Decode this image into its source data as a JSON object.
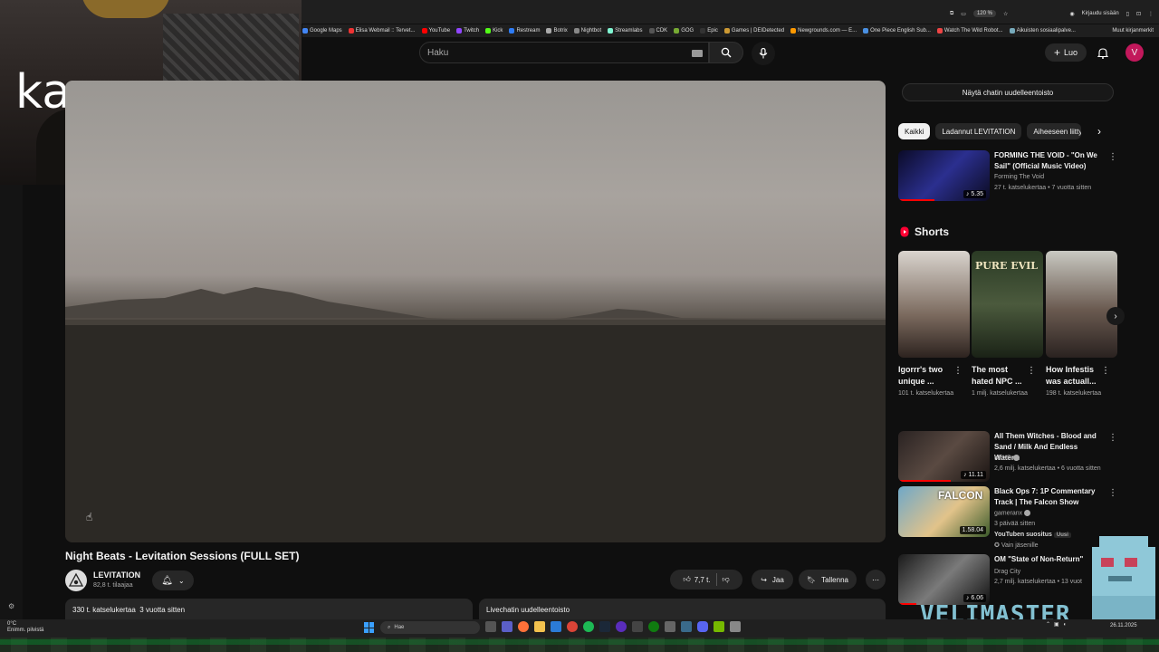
{
  "browser": {
    "zoom": "120 %",
    "sign_in": "Kirjaudu sisään",
    "other_bookmarks": "Muut kirjanmerkit",
    "bookmarks": [
      "Google Maps",
      "Elisa Webmail :: Tervet...",
      "YouTube",
      "Twitch",
      "Kick",
      "Restream",
      "Botrix",
      "Nightbot",
      "Streamlabs",
      "CDK",
      "GOG",
      "Epic",
      "Games | DEIDetected",
      "Newgrounds.com — E...",
      "One Piece English Sub...",
      "Watch The Wild Robot...",
      "Aikuisten sosiaalipalve..."
    ]
  },
  "webcam": {
    "caption": "kaupassa"
  },
  "header": {
    "search_placeholder": "Haku",
    "create_label": "Luo",
    "avatar_letter": "V"
  },
  "video": {
    "title": "Night Beats - Levitation Sessions (FULL SET)",
    "channel_name": "LEVITATION",
    "channel_subs": "82,8 t. tilaajaa",
    "likes": "7,7 t.",
    "share_label": "Jaa",
    "save_label": "Tallenna",
    "stats": "330 t. katselukertaa  3 vuotta sitten",
    "live_replay_label": "Livechatin uudelleentoisto"
  },
  "sidebar": {
    "chat_replay_button": "Näytä chatin uudelleentoisto",
    "chips": [
      "Kaikki",
      "Ladannut LEVITATION",
      "Aiheeseen liitty"
    ],
    "recommended_top": {
      "title": "FORMING THE VOID - \"On We Sail\" (Official Music Video)",
      "channel": "Forming The Void",
      "meta": "27 t. katselukertaa • 7 vuotta sitten",
      "duration": "5.35"
    },
    "shorts_header": "Shorts",
    "shorts": [
      {
        "title": "Igorrr's two unique ...",
        "views": "101 t. katselukertaa"
      },
      {
        "title": "The most hated NPC ...",
        "views": "1 milj. katselukertaa"
      },
      {
        "title": "How Infestis was actuall...",
        "views": "198 t. katselukertaa"
      }
    ],
    "recommended": [
      {
        "title": "All Them Witches - Blood and Sand / Milk And Endless Water...",
        "channel": "KEXP",
        "meta": "2,6 milj. katselukertaa • 6 vuotta sitten",
        "duration": "11.11"
      },
      {
        "title": "Black Ops 7: 1P Commentary Track | The Falcon Show",
        "channel": "gameranx",
        "meta": "3 päivää sitten",
        "extra": "YouTuben suositus",
        "new_badge": "Uusi",
        "member_label": "Vain jäsenille",
        "duration": "1.58.04"
      },
      {
        "title": "OM \"State of Non-Return\"",
        "channel": "Drag City",
        "meta": "2,7 milj. katselukertaa • 13 vuot",
        "duration": "6.06"
      }
    ]
  },
  "taskbar": {
    "weather_temp": "0°C",
    "weather_desc": "Enimm. pilvistä",
    "search_label": "Hae",
    "date": "26.11.2025"
  },
  "overlay": {
    "brand": "VELIMASTER"
  }
}
